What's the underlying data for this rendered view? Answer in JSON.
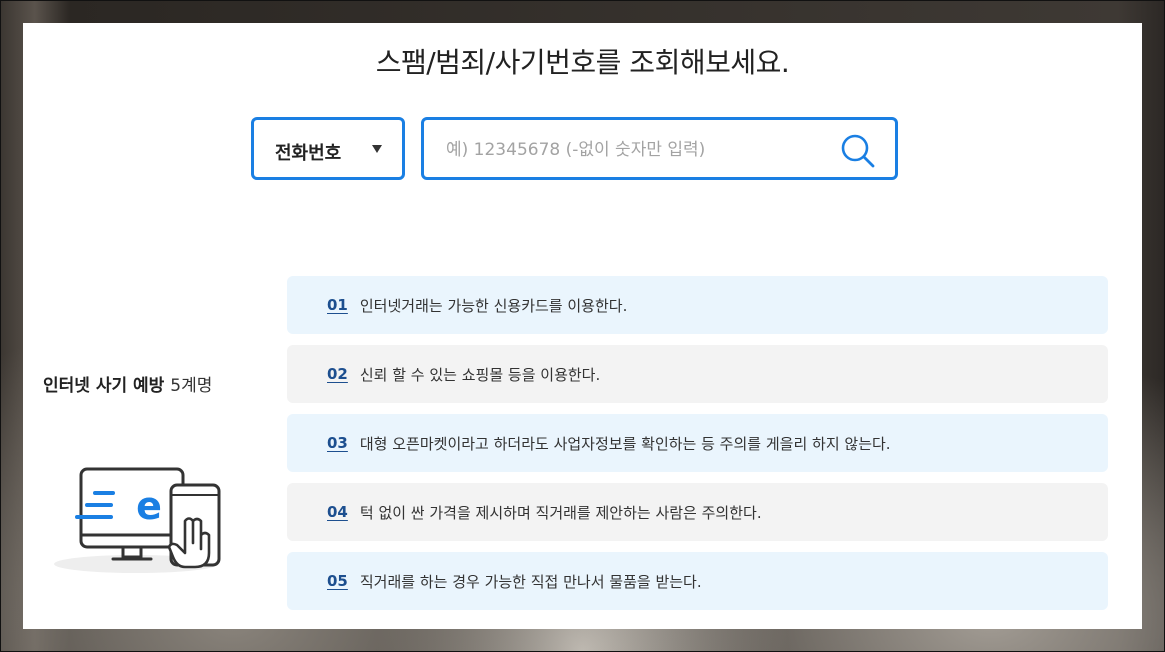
{
  "header": {
    "title": "스팸/범죄/사기번호를 조회해보세요."
  },
  "search": {
    "type_selected": "전화번호",
    "placeholder": "예) 12345678 (-없이 숫자만 입력)",
    "value": ""
  },
  "section": {
    "title": "인터넷 사기 예방",
    "count": "5계명"
  },
  "tips": [
    {
      "num": "01",
      "text": "인터넷거래는 가능한 신용카드를 이용한다."
    },
    {
      "num": "02",
      "text": "신뢰 할 수 있는 쇼핑몰 등을 이용한다."
    },
    {
      "num": "03",
      "text": "대형 오픈마켓이라고 하더라도 사업자정보를 확인하는 등 주의를 게을리 하지 않는다."
    },
    {
      "num": "04",
      "text": "턱 없이 싼 가격을 제시하며 직거래를 제안하는 사람은 주의한다."
    },
    {
      "num": "05",
      "text": "직거래를 하는 경우 가능한 직접 만나서 물품을 받는다."
    }
  ],
  "colors": {
    "accent": "#1a7fe3",
    "tip_blue": "#eaf5fd",
    "tip_gray": "#f3f3f3",
    "number": "#1d4f8f"
  },
  "icons": {
    "search": "search-icon",
    "caret": "triangle-down-icon",
    "illustration": "computer-phone-e-icon"
  }
}
